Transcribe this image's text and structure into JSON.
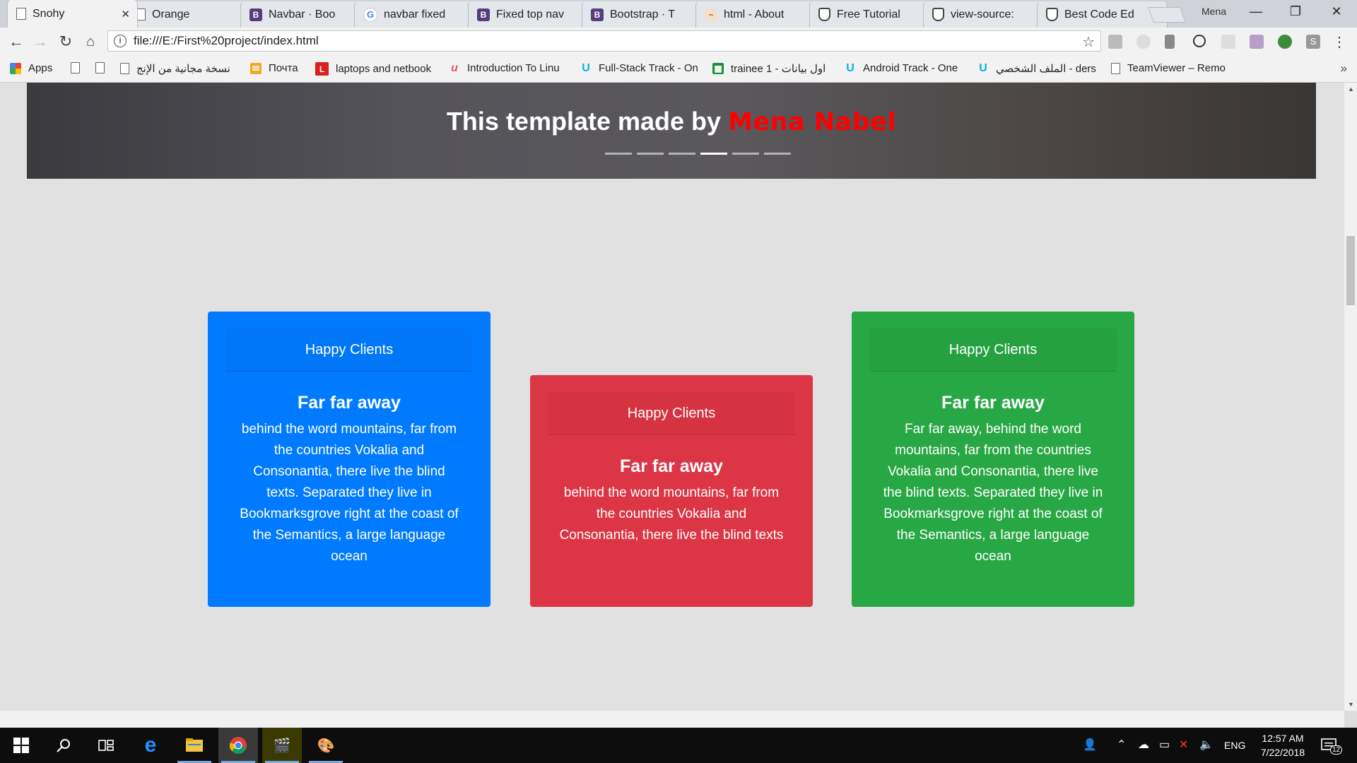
{
  "browser": {
    "tabs": [
      {
        "label": "Snohy",
        "icon": "page-icon",
        "active": true
      },
      {
        "label": "Orange",
        "icon": "page-icon"
      },
      {
        "label": "Navbar · Boo",
        "icon": "bootstrap-icon"
      },
      {
        "label": "navbar fixed",
        "icon": "google-icon"
      },
      {
        "label": "Fixed top nav",
        "icon": "bootstrap-icon"
      },
      {
        "label": "Bootstrap · T",
        "icon": "bootstrap-icon"
      },
      {
        "label": "html - About",
        "icon": "html-icon"
      },
      {
        "label": "Free Tutorial",
        "icon": "shield-icon"
      },
      {
        "label": "view-source:",
        "icon": "shield-icon"
      },
      {
        "label": "Best Code Ed",
        "icon": "shield-icon"
      }
    ],
    "tab_close_glyph": "✕",
    "profile_name": "Mena",
    "window_controls": {
      "minimize": "—",
      "maximize": "❐",
      "close": "✕"
    },
    "url": "file:///E:/First%20project/index.html",
    "omni_info_glyph": "i",
    "star_glyph": "☆",
    "bookmarks": [
      {
        "label": "Apps",
        "icon": "apps-icon"
      },
      {
        "label": "",
        "icon": "page-icon"
      },
      {
        "label": "",
        "icon": "page-icon"
      },
      {
        "label": "نسخة مجانية من الإنج",
        "icon": "page-icon"
      },
      {
        "label": "Почта",
        "icon": "mail-icon"
      },
      {
        "label": "laptops and netbook",
        "icon": "l-icon"
      },
      {
        "label": "Introduction To Linu",
        "icon": "udacity-red-icon"
      },
      {
        "label": "Full-Stack Track - On",
        "icon": "udacity-icon"
      },
      {
        "label": "trainee 1 - اول بيانات",
        "icon": "sheets-icon"
      },
      {
        "label": "Android Track - One",
        "icon": "udacity-icon"
      },
      {
        "label": "الملف الشخصي - ders",
        "icon": "udacity-icon"
      },
      {
        "label": "TeamViewer – Remo",
        "icon": "page-icon"
      }
    ],
    "bookmarks_more": "»"
  },
  "page": {
    "carousel": {
      "caption_prefix": "This template made by",
      "caption_author": "Mena Nabel",
      "indicators_count": 6,
      "active_indicator": 3
    },
    "cards": [
      {
        "id": "blue",
        "color": "#007bff",
        "header": "Happy Clients",
        "title": "Far far away",
        "text": "behind the word mountains, far from the countries Vokalia and Consonantia, there live the blind texts. Separated they live in Bookmarksgrove right at the coast of the Semantics, a large language ocean"
      },
      {
        "id": "red",
        "color": "#dc3545",
        "header": "Happy Clients",
        "title": "Far far away",
        "text": "behind the word mountains, far from the countries Vokalia and Consonantia, there live the blind texts"
      },
      {
        "id": "green",
        "color": "#28a745",
        "header": "Happy Clients",
        "title": "Far far away",
        "text": "Far far away, behind the word mountains, far from the countries Vokalia and Consonantia, there live the blind texts. Separated they live in Bookmarksgrove right at the coast of the Semantics, a large language ocean"
      }
    ]
  },
  "taskbar": {
    "apps": [
      "start-icon",
      "search-icon",
      "task-view-icon",
      "edge-icon",
      "file-explorer-icon",
      "chrome-icon",
      "media-app-icon",
      "paint-app-icon"
    ],
    "language": "ENG",
    "time": "12:57 AM",
    "date": "7/22/2018",
    "notification_count": "12"
  }
}
